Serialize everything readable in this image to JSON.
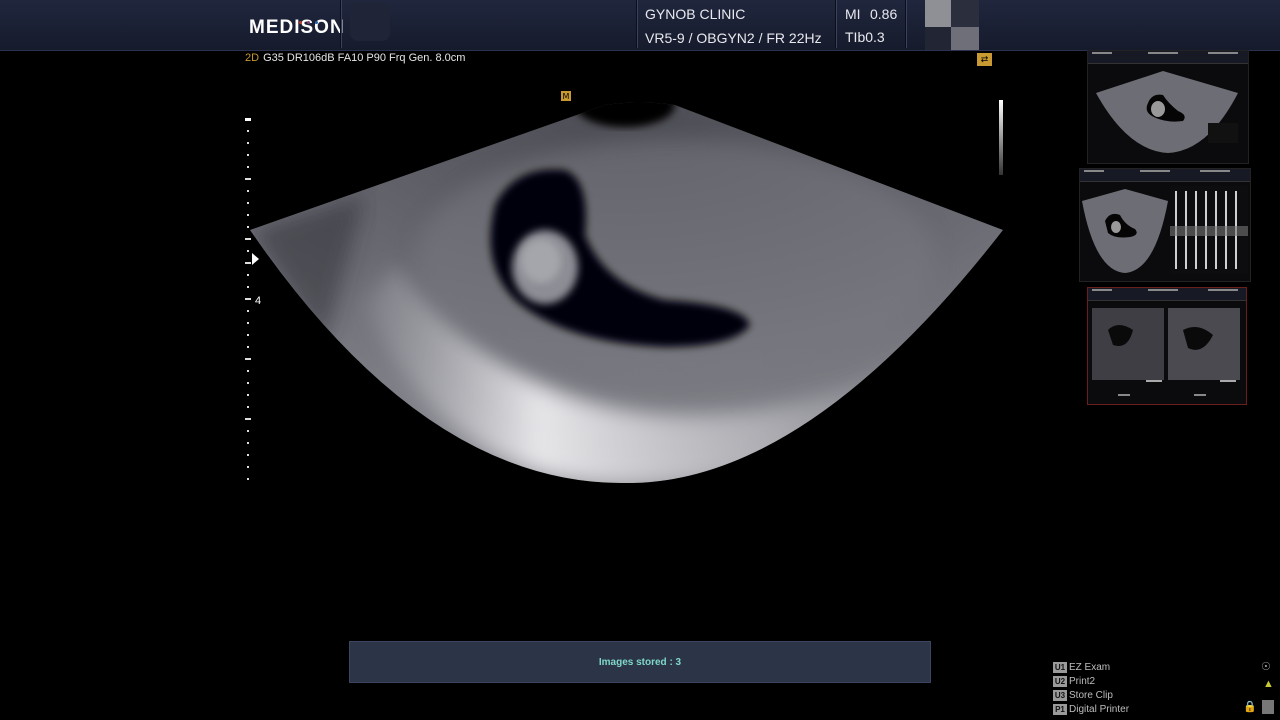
{
  "header": {
    "logo": "MEDISON",
    "logo_dot_colors": [
      "#c0392b",
      "#7b3f7b",
      "#1f5fa8"
    ],
    "clinic": "GYNOB CLINIC",
    "probe_info": "VR5-9 / OBGYN2 / FR 22Hz",
    "mi_label": "MI",
    "mi_value": "0.86",
    "tib": "TIb0.3"
  },
  "image_params": {
    "mode": "2D",
    "settings": "G35 DR106dB FA10 P90 Frq Gen. 8.0cm"
  },
  "depth_scale": {
    "mid_label": "4",
    "depth_cm": 8.0
  },
  "status": {
    "message": "Images stored : 3"
  },
  "user_keys": [
    {
      "key": "U1",
      "label": "EZ Exam"
    },
    {
      "key": "U2",
      "label": "Print2"
    },
    {
      "key": "U3",
      "label": "Store Clip"
    },
    {
      "key": "P1",
      "label": "Digital Printer"
    }
  ],
  "icons": {
    "orientation": "orientation-marker-icon",
    "lock": "lock-icon",
    "probe": "probe-icon",
    "gel": "gel-icon"
  },
  "colors": {
    "header_bg": "#1b2134",
    "accent_orange": "#c99a32",
    "status_text": "#7fd8c9",
    "status_bg": "#2c3447"
  }
}
